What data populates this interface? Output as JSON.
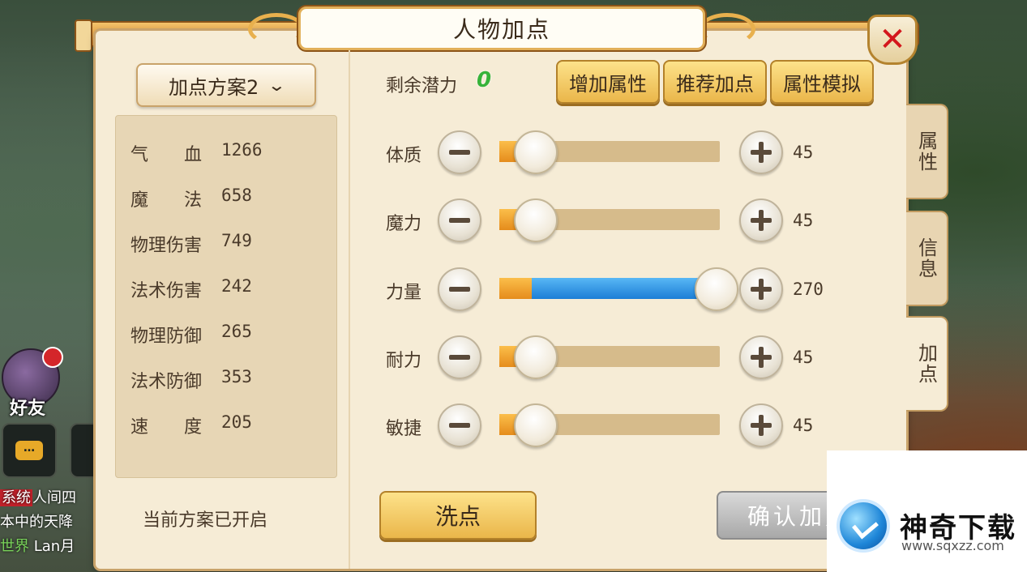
{
  "window": {
    "title": "人物加点",
    "close_icon": "close-icon"
  },
  "left_hud": {
    "friends_label": "好友",
    "chat_icon": "…",
    "chat_lines": [
      {
        "tag": "系统",
        "text": "人间四"
      },
      {
        "tag": "",
        "text": "本中的天降"
      },
      {
        "tag": "世界",
        "text": "Lan月"
      }
    ]
  },
  "scheme": {
    "selected": "加点方案2",
    "status": "当前方案已开启"
  },
  "stats": [
    {
      "name": "气　　血",
      "value": "1266"
    },
    {
      "name": "魔　　法",
      "value": "658"
    },
    {
      "name": "物理伤害",
      "value": "749"
    },
    {
      "name": "法术伤害",
      "value": "242"
    },
    {
      "name": "物理防御",
      "value": "265"
    },
    {
      "name": "法术防御",
      "value": "353"
    },
    {
      "name": "速　　度",
      "value": "205"
    }
  ],
  "potential": {
    "label": "剩余潜力",
    "value": "0"
  },
  "actions": {
    "add": "增加属性",
    "recommend": "推荐加点",
    "simulate": "属性模拟"
  },
  "attributes": [
    {
      "name": "体质",
      "value": "45",
      "fraction": 0.0
    },
    {
      "name": "魔力",
      "value": "45",
      "fraction": 0.0
    },
    {
      "name": "力量",
      "value": "270",
      "fraction": 1.0
    },
    {
      "name": "耐力",
      "value": "45",
      "fraction": 0.0
    },
    {
      "name": "敏捷",
      "value": "45",
      "fraction": 0.0
    }
  ],
  "buttons": {
    "reset": "洗点",
    "confirm": "确认加点"
  },
  "side_tabs": [
    "属性",
    "信息",
    "加点"
  ],
  "watermark": {
    "name": "神奇下载",
    "url": "www.sqxzz.com"
  },
  "colors": {
    "accent_gold": "#eab64a",
    "slider_blue": "#1c7ed6",
    "potential_green": "#37b33a",
    "close_red": "#d3161c"
  }
}
